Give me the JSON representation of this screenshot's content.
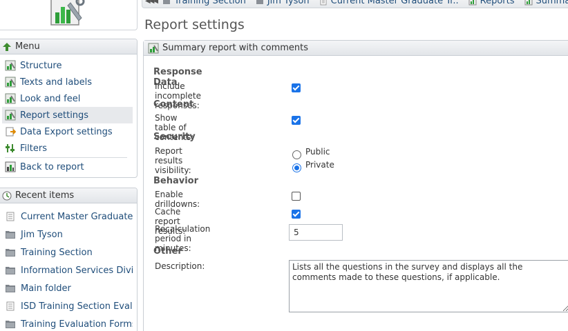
{
  "breadcrumb": {
    "items": [
      {
        "label": "Training Section",
        "icon": "folder-icon"
      },
      {
        "label": "Jim Tyson",
        "icon": "folder-icon"
      },
      {
        "label": "Current Master Graduate Tr..",
        "icon": "survey-icon"
      },
      {
        "label": "Reports",
        "icon": "reports-icon"
      },
      {
        "label": "Summary report with comments",
        "icon": "reports-icon"
      }
    ]
  },
  "page": {
    "title": "Report settings"
  },
  "menu": {
    "title": "Menu",
    "items": [
      {
        "label": "Structure"
      },
      {
        "label": "Texts and labels"
      },
      {
        "label": "Look and feel"
      },
      {
        "label": "Report settings"
      },
      {
        "label": "Data Export settings"
      },
      {
        "label": "Filters"
      },
      {
        "label": "Back to report"
      }
    ]
  },
  "recent": {
    "title": "Recent items",
    "items": [
      {
        "label": "Current Master Graduate Tr",
        "icon": "survey-icon"
      },
      {
        "label": "Jim Tyson",
        "icon": "folder-icon"
      },
      {
        "label": "Training Section",
        "icon": "folder-icon"
      },
      {
        "label": "Information Services Divis..",
        "icon": "folder-icon"
      },
      {
        "label": "Main folder",
        "icon": "folder-icon"
      },
      {
        "label": "ISD Training Section Evalu..",
        "icon": "survey-icon"
      },
      {
        "label": "Training Evaluation Forms",
        "icon": "folder-icon"
      }
    ]
  },
  "report": {
    "title": "Summary report with comments",
    "sections": {
      "response_data": "Response Data",
      "content": "Content",
      "security": "Security",
      "behavior": "Behavior",
      "other": "Other"
    },
    "fields": {
      "include_incomplete": {
        "label": "Include incomplete responses:",
        "checked": true
      },
      "show_toc": {
        "label": "Show table of contents:",
        "checked": true
      },
      "visibility": {
        "label": "Report results visibility:",
        "options": [
          "Public",
          "Private"
        ],
        "selected": "Private"
      },
      "enable_drilldowns": {
        "label": "Enable drilldowns:",
        "checked": false
      },
      "cache_results": {
        "label": "Cache report results:",
        "checked": true
      },
      "recalc_period": {
        "label": "Recalculation period in minutes:",
        "value": "5"
      },
      "description": {
        "label": "Description:",
        "value": "Lists all the questions in the survey and displays all the comments made to these questions, if applicable."
      }
    }
  },
  "colors": {
    "accent": "#1a73e8",
    "link": "#1f4d7a"
  }
}
